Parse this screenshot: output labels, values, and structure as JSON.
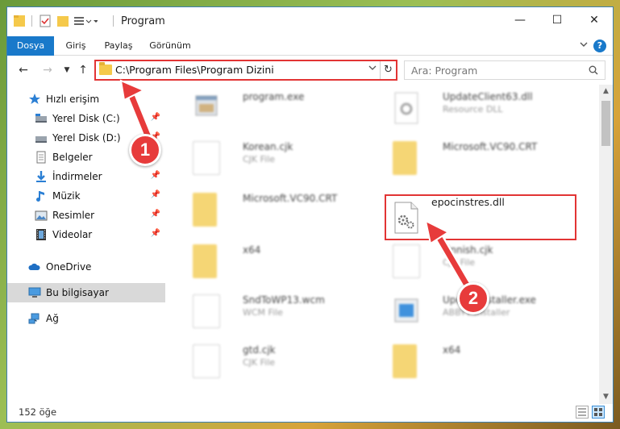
{
  "window": {
    "title": "Program",
    "controls": {
      "minimize": "—",
      "maximize": "☐",
      "close": "✕"
    }
  },
  "ribbon": {
    "tabs": [
      "Dosya",
      "Giriş",
      "Paylaş",
      "Görünüm"
    ],
    "help": "?"
  },
  "nav": {
    "address": "C:\\Program Files\\Program Dizini",
    "search_placeholder": "Ara: Program"
  },
  "sidebar": {
    "items": [
      {
        "label": "Hızlı erişim",
        "icon": "star-icon"
      },
      {
        "label": "Yerel Disk (C:)",
        "icon": "drive-icon"
      },
      {
        "label": "Yerel Disk (D:)",
        "icon": "drive-icon"
      },
      {
        "label": "Belgeler",
        "icon": "documents-icon"
      },
      {
        "label": "İndirmeler",
        "icon": "download-icon"
      },
      {
        "label": "Müzik",
        "icon": "music-icon"
      },
      {
        "label": "Resimler",
        "icon": "pictures-icon"
      },
      {
        "label": "Videolar",
        "icon": "videos-icon"
      },
      {
        "label": "OneDrive",
        "icon": "cloud-icon"
      },
      {
        "label": "Bu bilgisayar",
        "icon": "computer-icon"
      },
      {
        "label": "Ağ",
        "icon": "network-icon"
      }
    ]
  },
  "files": [
    {
      "name": "program.exe",
      "type": "",
      "icon": "exe-icon"
    },
    {
      "name": "UpdateClient63.dll",
      "type": "Resource DLL",
      "icon": "dll-icon"
    },
    {
      "name": "Korean.cjk",
      "type": "CJK File",
      "icon": "file-icon"
    },
    {
      "name": "Microsoft.VC90.CRT",
      "type": "",
      "icon": "folder-icon"
    },
    {
      "name": "Microsoft.VC90.CRT",
      "type": "",
      "icon": "folder-icon"
    },
    {
      "name": "epocinstres.dll",
      "type": "",
      "icon": "gear-file-icon"
    },
    {
      "name": "x64",
      "type": "",
      "icon": "folder-icon"
    },
    {
      "name": "Finnish.cjk",
      "type": "CJK File",
      "icon": "file-icon"
    },
    {
      "name": "SndToWP13.wcm",
      "type": "WCM File",
      "icon": "file-icon"
    },
    {
      "name": "UpdateInstaller.exe",
      "type": "ABBYY Installer",
      "icon": "installer-icon"
    },
    {
      "name": "gtd.cjk",
      "type": "CJK File",
      "icon": "file-icon"
    },
    {
      "name": "x64",
      "type": "",
      "icon": "folder-icon"
    }
  ],
  "status": {
    "count": "152 öğe"
  },
  "annotations": [
    "1",
    "2"
  ],
  "colors": {
    "accent": "#1979ca",
    "highlight": "#e23434",
    "selection": "#cce8ff"
  }
}
